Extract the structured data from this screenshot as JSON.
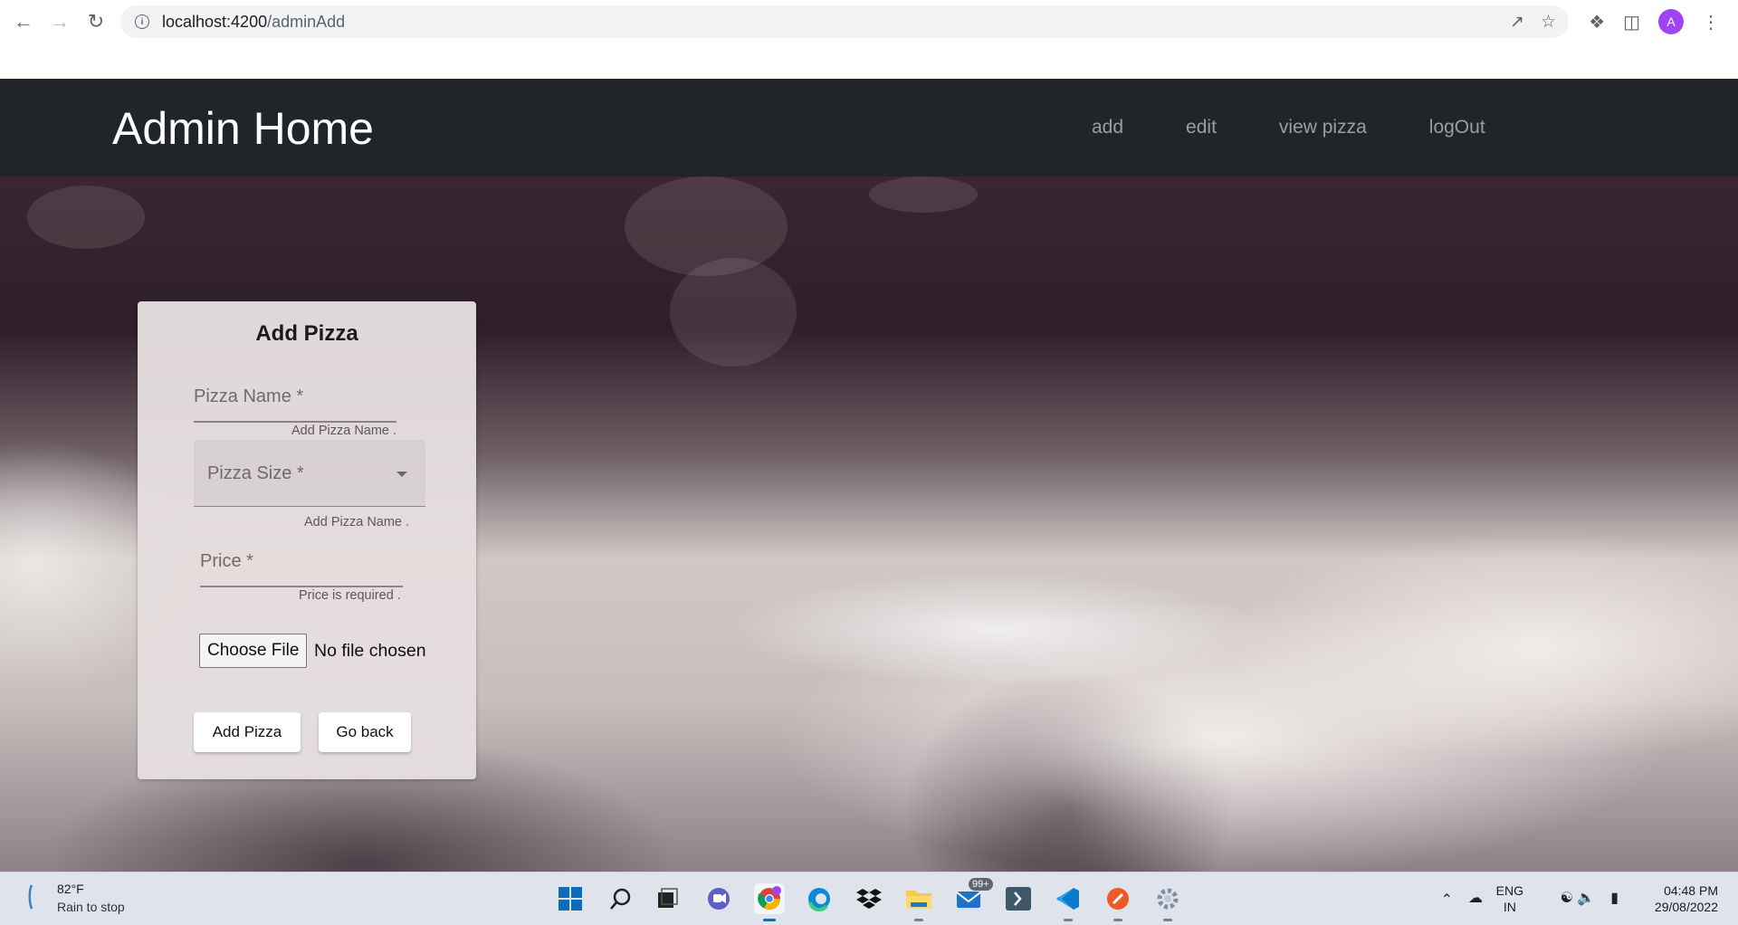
{
  "browser": {
    "url_host": "localhost:4200",
    "url_path": "/adminAdd",
    "profile_initial": "A"
  },
  "header": {
    "title": "Admin Home",
    "nav": [
      "add",
      "edit",
      "view pizza",
      "logOut"
    ]
  },
  "form": {
    "title": "Add Pizza",
    "pizza_name_label": "Pizza Name *",
    "pizza_name_hint": "Add Pizza Name .",
    "pizza_size_label": "Pizza Size *",
    "pizza_size_hint": "Add Pizza Name .",
    "price_label": "Price *",
    "price_hint": "Price is required .",
    "file_button": "Choose File",
    "file_status": "No file chosen",
    "submit_label": "Add Pizza",
    "back_label": "Go back"
  },
  "taskbar": {
    "temperature": "82°F",
    "weather": "Rain to stop",
    "mail_badge": "99+",
    "lang_top": "ENG",
    "lang_bottom": "IN",
    "time": "04:48 PM",
    "date": "29/08/2022"
  },
  "colors": {
    "header_bg": "#212529",
    "card_bg": "#e5dede",
    "taskbar_bg": "#dfe4ec"
  }
}
